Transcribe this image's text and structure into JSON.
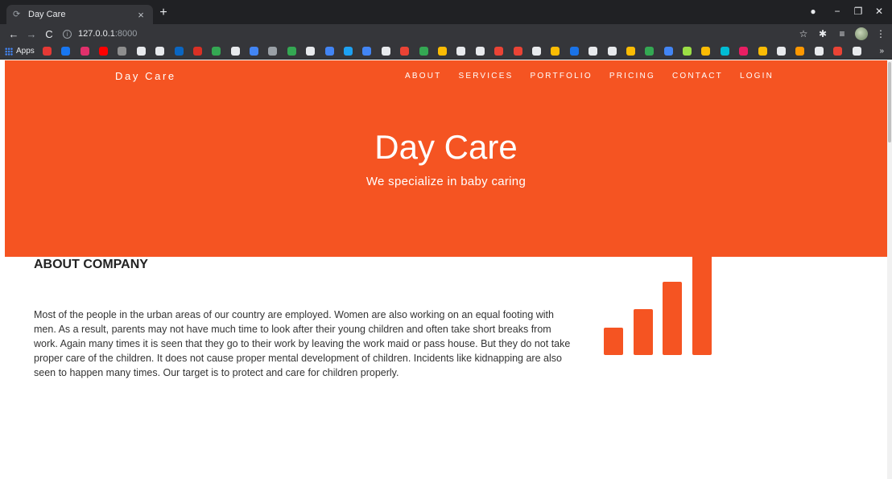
{
  "browser": {
    "tab_title": "Day Care",
    "tab_close": "×",
    "new_tab": "+",
    "url_host": "127.0.0.1",
    "url_port": ":8000",
    "bookmarks_apps_label": "Apps",
    "bookmarks_more": "»",
    "bookmark_colors": [
      "#e53935",
      "#1877f2",
      "#e1306c",
      "#ff0000",
      "#8e8e8e",
      "#e8eaed",
      "#e8eaed",
      "#0a66c2",
      "#d93025",
      "#34a853",
      "#e8eaed",
      "#4285f4",
      "#9aa0a6",
      "#34a853",
      "#e8eaed",
      "#4285f4",
      "#1da1f2",
      "#4285f4",
      "#e8eaed",
      "#ea4335",
      "#34a853",
      "#fbbc04",
      "#e8eaed",
      "#e8eaed",
      "#ea4335",
      "#ea4335",
      "#e8eaed",
      "#fbbc04",
      "#1a73e8",
      "#e8eaed",
      "#e8eaed",
      "#fbbc04",
      "#34a853",
      "#4285f4",
      "#9bde45",
      "#fbbc04",
      "#00bcd4",
      "#e91e63",
      "#fbbc04",
      "#e8eaed",
      "#ff9800",
      "#e8eaed",
      "#ea4335",
      "#e8eaed"
    ]
  },
  "site": {
    "brand": "Day Care",
    "nav": [
      "ABOUT",
      "SERVICES",
      "PORTFOLIO",
      "PRICING",
      "CONTACT",
      "LOGIN"
    ],
    "hero_title": "Day Care",
    "hero_subtitle": "We specialize in baby caring",
    "accent_color": "#f55422"
  },
  "about": {
    "heading": "ABOUT COMPANY",
    "text": "Most of the people in the urban areas of our country are employed. Women are also working on an equal footing with men. As a result, parents may not have much time to look after their young children and often take short breaks from work. Again many times it is seen that they go to their work by leaving the work maid or pass house. But they do not take proper care of the children. It does not cause proper mental development of children. Incidents like kidnapping are also seen to happen many times. Our target is to protect and care for children properly.",
    "icon": "signal-bars-icon"
  }
}
